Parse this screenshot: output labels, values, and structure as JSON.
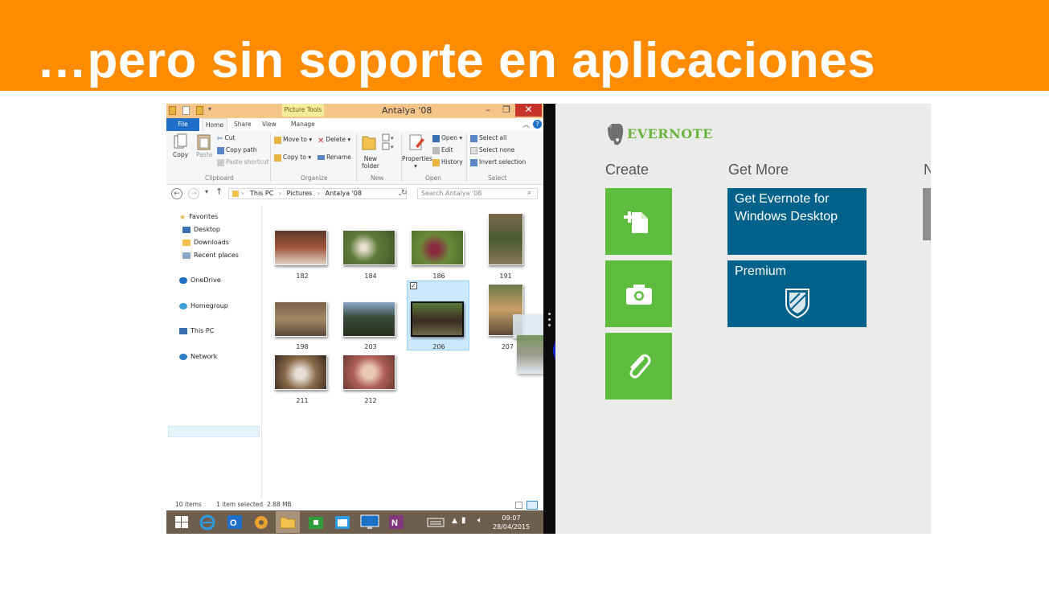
{
  "slide": {
    "title": "…pero sin soporte en aplicaciones",
    "accent": "#ff8c00"
  },
  "explorer": {
    "contextual_tab": "Picture Tools",
    "window_title": "Antalya '08",
    "tabs": [
      "File",
      "Home",
      "Share",
      "View",
      "Manage"
    ],
    "ribbon": {
      "clipboard": {
        "copy": "Copy",
        "paste": "Paste",
        "cut": "Cut",
        "copy_path": "Copy path",
        "paste_shortcut": "Paste shortcut",
        "label": "Clipboard"
      },
      "organize": {
        "move_to": "Move to",
        "copy_to": "Copy to",
        "delete": "Delete",
        "rename": "Rename",
        "label": "Organize"
      },
      "new": {
        "new_folder_1": "New",
        "new_folder_2": "folder",
        "label": "New"
      },
      "open": {
        "properties": "Properties",
        "open": "Open",
        "edit": "Edit",
        "history": "History",
        "label": "Open"
      },
      "select": {
        "select_all": "Select all",
        "select_none": "Select none",
        "invert_selection": "Invert selection",
        "label": "Select"
      }
    },
    "breadcrumb": [
      "This PC",
      "Pictures",
      "Antalya '08"
    ],
    "search_placeholder": "Search Antalya '08",
    "nav": {
      "favorites": "Favorites",
      "desktop": "Desktop",
      "downloads": "Downloads",
      "recent_places": "Recent places",
      "onedrive": "OneDrive",
      "homegroup": "Homegroup",
      "this_pc": "This PC",
      "network": "Network"
    },
    "files": [
      "182",
      "184",
      "186",
      "191",
      "198",
      "203",
      "206",
      "207",
      "211",
      "212"
    ],
    "status": {
      "items": "10 items",
      "selected": "1 item selected",
      "size": "2.88 MB"
    },
    "taskbar": {
      "time": "09:07",
      "date": "28/04/2015"
    }
  },
  "evernote": {
    "logo": "EVERNOTE",
    "create_heading": "Create",
    "get_more_heading": "Get More",
    "next_heading_partial": "N",
    "create_tiles": [
      "new-note-icon",
      "camera-icon",
      "paperclip-icon"
    ],
    "get_more_tiles": {
      "desktop_line1": "Get Evernote for",
      "desktop_line2": "Windows Desktop",
      "premium": "Premium"
    },
    "brand_green": "#5ebd3e",
    "brand_blue": "#00628b"
  }
}
